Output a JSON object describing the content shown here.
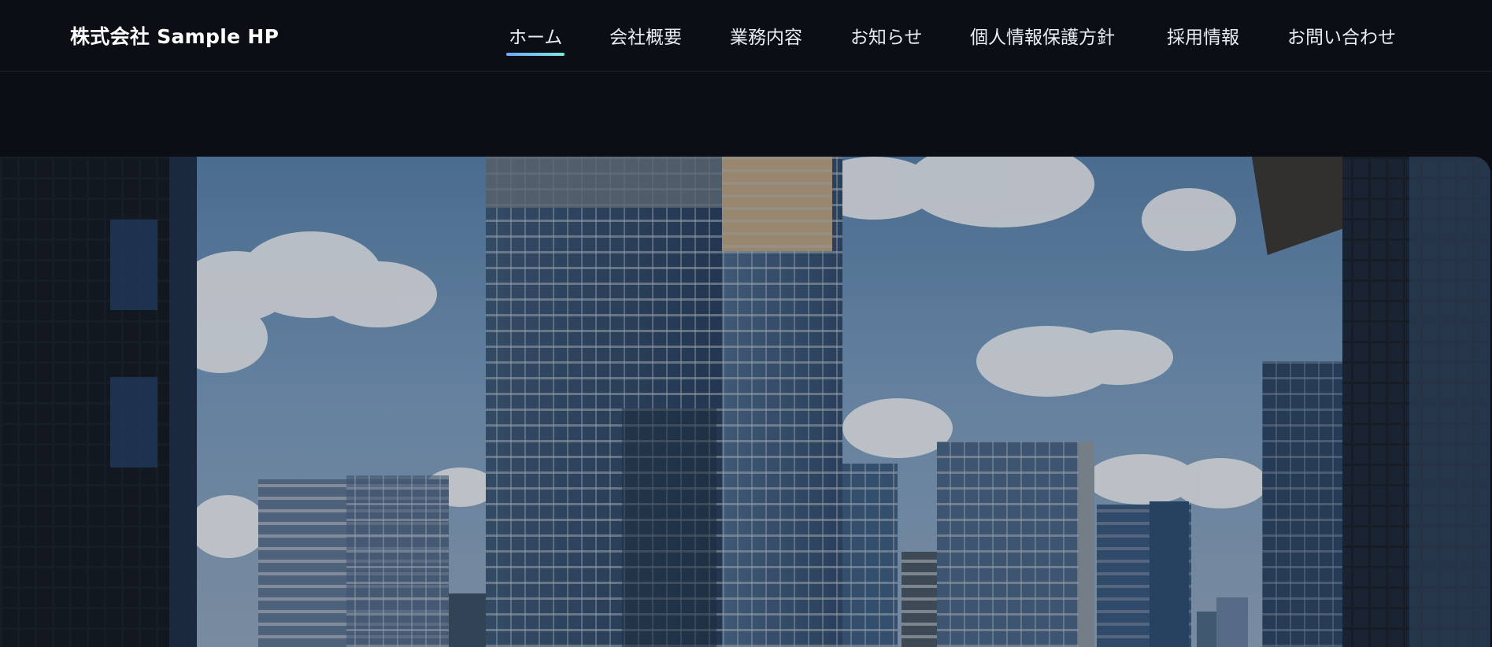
{
  "header": {
    "brand": "株式会社 Sample HP",
    "nav": [
      {
        "label": "ホーム",
        "active": true
      },
      {
        "label": "会社概要",
        "active": false
      },
      {
        "label": "業務内容",
        "active": false
      },
      {
        "label": "お知らせ",
        "active": false
      },
      {
        "label": "個人情報保護方針",
        "active": false
      },
      {
        "label": "採用情報",
        "active": false
      },
      {
        "label": "お問い合わせ",
        "active": false
      }
    ]
  },
  "hero": {
    "image": "city-skyscrapers-photo"
  },
  "colors": {
    "background": "#0b0e14",
    "nav_text": "#e9edf3",
    "active_underline": "#7ee8d9"
  }
}
